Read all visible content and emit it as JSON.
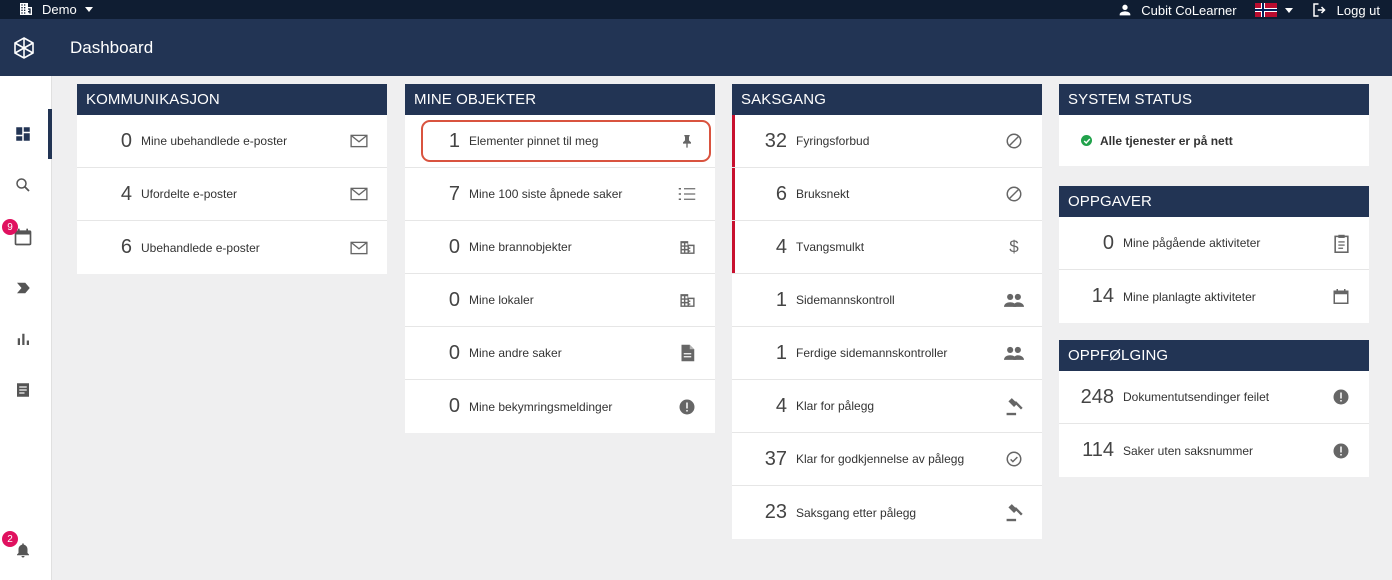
{
  "topbar": {
    "tenant": "Demo",
    "user": "Cubit CoLearner",
    "logout": "Logg ut"
  },
  "header": {
    "title": "Dashboard"
  },
  "sidebar": {
    "calendar_badge": "9",
    "notification_badge": "2"
  },
  "kommunikasjon": {
    "title": "KOMMUNIKASJON",
    "rows": [
      {
        "count": "0",
        "label": "Mine ubehandlede e-poster",
        "icon": "mail-icon"
      },
      {
        "count": "4",
        "label": "Ufordelte e-poster",
        "icon": "mail-icon"
      },
      {
        "count": "6",
        "label": "Ubehandlede e-poster",
        "icon": "mail-icon"
      }
    ]
  },
  "mine_objekter": {
    "title": "MINE OBJEKTER",
    "rows": [
      {
        "count": "1",
        "label": "Elementer pinnet til meg",
        "icon": "pin-icon"
      },
      {
        "count": "7",
        "label": "Mine 100 siste åpnede saker",
        "icon": "list-icon"
      },
      {
        "count": "0",
        "label": "Mine brannobjekter",
        "icon": "building-icon"
      },
      {
        "count": "0",
        "label": "Mine lokaler",
        "icon": "building-icon"
      },
      {
        "count": "0",
        "label": "Mine andre saker",
        "icon": "document-icon"
      },
      {
        "count": "0",
        "label": "Mine bekymringsmeldinger",
        "icon": "alert-icon"
      }
    ]
  },
  "saksgang": {
    "title": "SAKSGANG",
    "rows": [
      {
        "count": "32",
        "label": "Fyringsforbud",
        "icon": "block-icon"
      },
      {
        "count": "6",
        "label": "Bruksnekt",
        "icon": "block-icon"
      },
      {
        "count": "4",
        "label": "Tvangsmulkt",
        "icon": "dollar-icon"
      },
      {
        "count": "1",
        "label": "Sidemannskontroll",
        "icon": "people-icon"
      },
      {
        "count": "1",
        "label": "Ferdige sidemannskontroller",
        "icon": "people-icon"
      },
      {
        "count": "4",
        "label": "Klar for pålegg",
        "icon": "gavel-icon"
      },
      {
        "count": "37",
        "label": "Klar for godkjennelse av pålegg",
        "icon": "check-circle-icon"
      },
      {
        "count": "23",
        "label": "Saksgang etter pålegg",
        "icon": "gavel-icon"
      }
    ]
  },
  "system_status": {
    "title": "SYSTEM STATUS",
    "message": "Alle tjenester er på nett"
  },
  "oppgaver": {
    "title": "OPPGAVER",
    "rows": [
      {
        "count": "0",
        "label": "Mine pågående aktiviteter",
        "icon": "clipboard-icon"
      },
      {
        "count": "14",
        "label": "Mine planlagte aktiviteter",
        "icon": "calendar-icon"
      }
    ]
  },
  "oppfolging": {
    "title": "OPPFØLGING",
    "rows": [
      {
        "count": "248",
        "label": "Dokumentutsendinger feilet",
        "icon": "alert-icon"
      },
      {
        "count": "114",
        "label": "Saker uten saksnummer",
        "icon": "alert-icon"
      }
    ]
  },
  "colors": {
    "header": "#223454",
    "topstrip": "#0f1d32",
    "highlight": "#d9533f",
    "alert_bar": "#c8102e",
    "status_ok": "#21a24b",
    "badge": "#e0115f"
  }
}
